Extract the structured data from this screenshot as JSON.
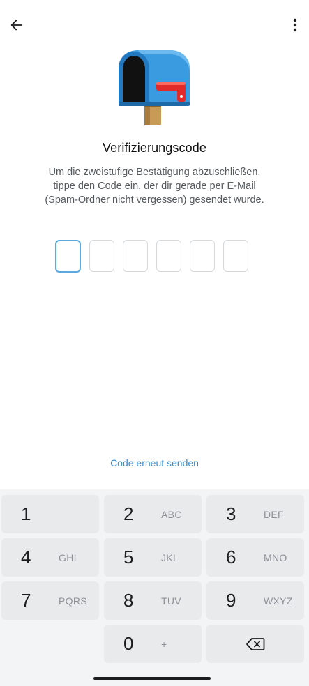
{
  "header": {
    "back_icon": "arrow-left-icon",
    "menu_icon": "more-vertical-icon"
  },
  "illustration": {
    "icon": "mailbox-icon",
    "body_color": "#3b9be0",
    "flag_color": "#e32a2a",
    "post_color": "#c89a55"
  },
  "title": "Verifizierungscode",
  "description": {
    "line1": "Um die zweistufige Bestätigung abzuschließen,",
    "line2": "tippe den Code ein, der dir gerade per E-Mail",
    "line3": "(Spam-Ordner nicht vergessen) gesendet wurde."
  },
  "code_input": {
    "length": 6,
    "values": [
      "",
      "",
      "",
      "",
      "",
      ""
    ],
    "active_index": 0
  },
  "resend_label": "Code erneut senden",
  "colors": {
    "accent": "#3a8fd0",
    "active_border": "#5aa9e0"
  },
  "keypad": {
    "keys": [
      {
        "num": "1",
        "letters": ""
      },
      {
        "num": "2",
        "letters": "ABC"
      },
      {
        "num": "3",
        "letters": "DEF"
      },
      {
        "num": "4",
        "letters": "GHI"
      },
      {
        "num": "5",
        "letters": "JKL"
      },
      {
        "num": "6",
        "letters": "MNO"
      },
      {
        "num": "7",
        "letters": "PQRS"
      },
      {
        "num": "8",
        "letters": "TUV"
      },
      {
        "num": "9",
        "letters": "WXYZ"
      },
      {
        "num": "",
        "letters": ""
      },
      {
        "num": "0",
        "letters": "+"
      },
      {
        "num": "",
        "letters": "",
        "icon": "backspace-icon"
      }
    ]
  }
}
